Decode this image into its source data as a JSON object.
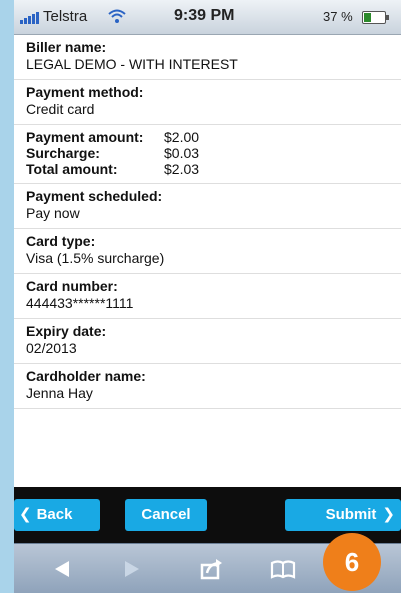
{
  "status_bar": {
    "carrier": "Telstra",
    "time": "9:39 PM",
    "battery": "37 %",
    "battery_level": 0.37
  },
  "sections": {
    "biller": {
      "label": "Biller name:",
      "value": "LEGAL DEMO - WITH INTEREST"
    },
    "method": {
      "label": "Payment method:",
      "value": "Credit card"
    },
    "amounts": {
      "payment_label": "Payment amount:",
      "payment_value": "$2.00",
      "surcharge_label": "Surcharge:",
      "surcharge_value": "$0.03",
      "total_label": "Total amount:",
      "total_value": "$2.03"
    },
    "scheduled": {
      "label": "Payment scheduled:",
      "value": "Pay now"
    },
    "card_type": {
      "label": "Card type:",
      "value": "Visa (1.5% surcharge)"
    },
    "card_number": {
      "label": "Card number:",
      "value": "444433******1111"
    },
    "expiry": {
      "label": "Expiry date:",
      "value": "02/2013"
    },
    "cardholder": {
      "label": "Cardholder name:",
      "value": "Jenna Hay"
    }
  },
  "toolbar": {
    "back_label": "Back",
    "cancel_label": "Cancel",
    "submit_label": "Submit"
  },
  "browser_bar": {
    "icons": [
      "back-arrow-icon",
      "forward-arrow-icon",
      "share-icon",
      "bookmarks-icon",
      "tabs-icon"
    ]
  },
  "step_badge": "6",
  "colors": {
    "accent": "#19a9e4",
    "toolbar_bg": "#0d0d0d",
    "badge": "#ef7f1a",
    "frame": "#a9d3ea"
  }
}
